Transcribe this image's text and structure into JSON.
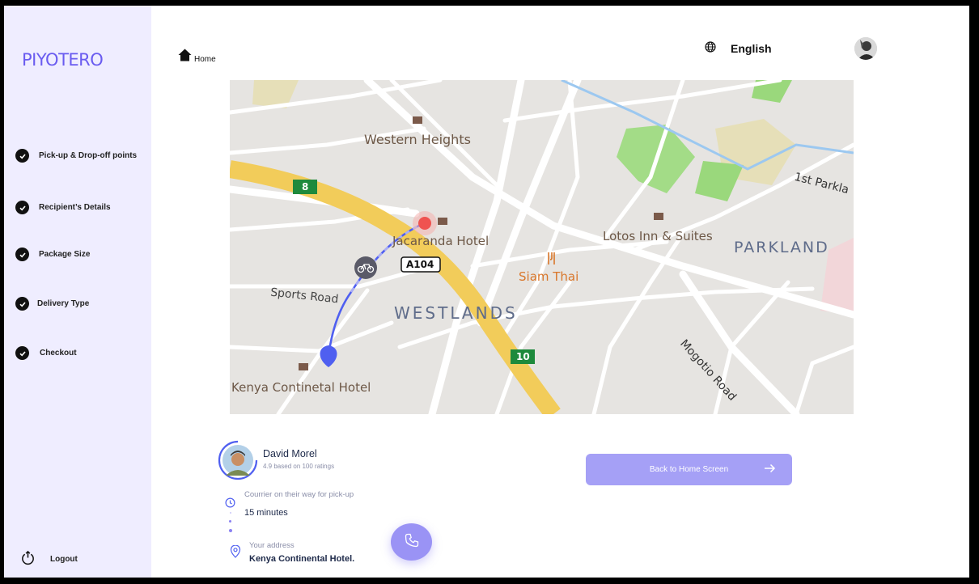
{
  "app": {
    "logo": "PIYOTERO"
  },
  "sidebar": {
    "steps": [
      {
        "label": "Pick-up & Drop-off points",
        "done": true
      },
      {
        "label": "Recipient’s Details",
        "done": true
      },
      {
        "label": "Package Size",
        "done": true
      },
      {
        "label": "Delivery Type",
        "done": true
      },
      {
        "label": "Checkout",
        "done": true
      }
    ],
    "logout_label": "Logout"
  },
  "header": {
    "breadcrumb": "Home",
    "language": "English"
  },
  "map": {
    "labels": {
      "western_heights": "Western Heights",
      "jacaranda": "Jacaranda Hotel",
      "lotos": "Lotos Inn & Suites",
      "parkland": "PARKLAND",
      "siam": "Siam Thai",
      "sports_road": "Sports Road",
      "westlands": "WESTLANDS",
      "mogotio": "Mogotio Road",
      "kenya_hotel": "Kenya Continetal Hotel",
      "first_parkland": "1st Parkla",
      "route_8": "8",
      "route_10": "10",
      "route_a104": "A104"
    },
    "colors": {
      "road_major": "#f2cc5a",
      "park": "#9ad87c",
      "route": "#4f5ff0",
      "pickup": "#ef5350"
    }
  },
  "courier": {
    "name": "David Morel",
    "rating_text": "4.9 based on 100 ratings",
    "status_label": "Courrier on their way for pick-up",
    "eta": "15 minutes",
    "address_label": "Your address",
    "address": "Kenya Continental Hotel."
  },
  "actions": {
    "back_home": "Back to Home Screen"
  },
  "theme": {
    "accent": "#6a5cf0",
    "sidebar_bg": "#efedff",
    "button_bg": "#a5a0f6"
  }
}
